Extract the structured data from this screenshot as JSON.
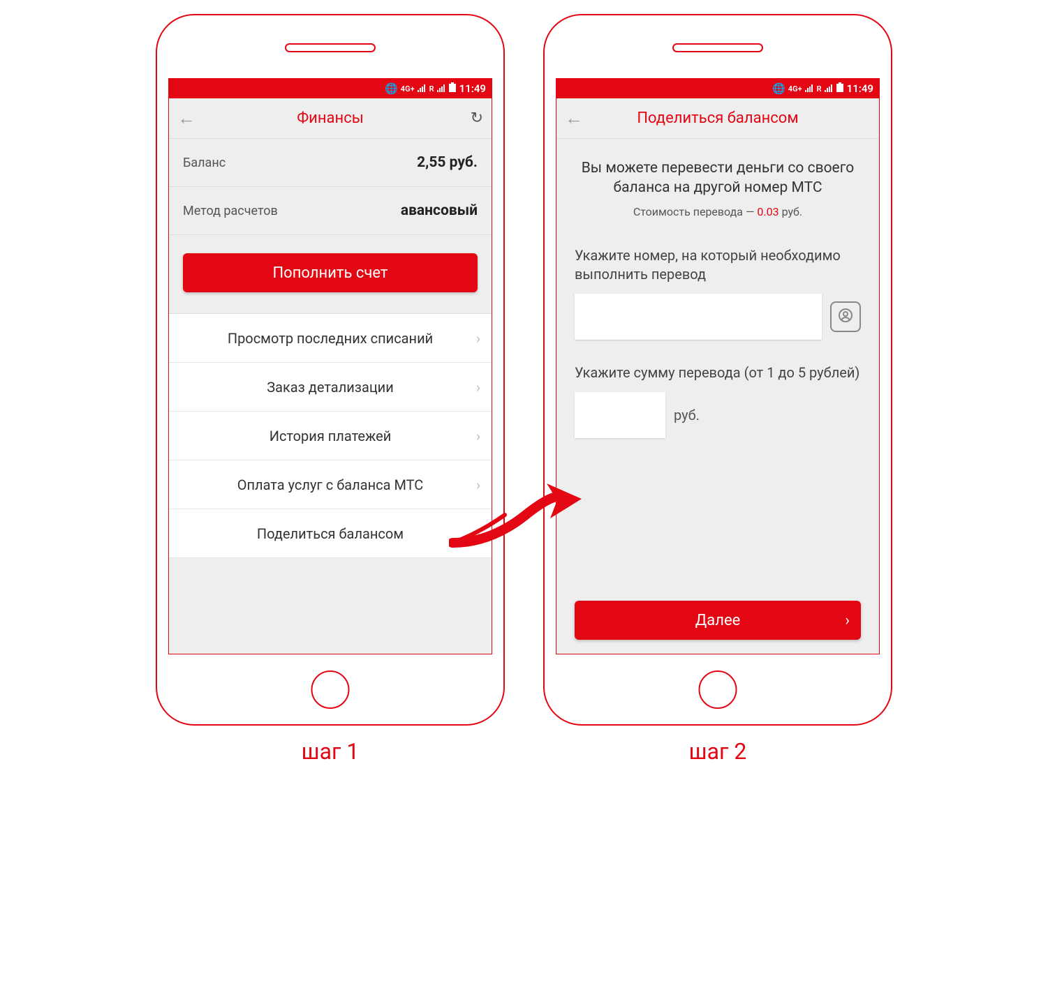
{
  "accent": "#e30613",
  "status": {
    "time": "11:49",
    "net_label": "4G+",
    "roam_label": "R",
    "icons": [
      "globe-icon",
      "4g-icon",
      "signal-icon",
      "signal-roaming-icon",
      "battery-icon"
    ]
  },
  "step_labels": {
    "s1": "шаг 1",
    "s2": "шаг 2"
  },
  "screen1": {
    "header_title": "Финансы",
    "balance_label": "Баланс",
    "balance_value": "2,55 руб.",
    "method_label": "Метод расчетов",
    "method_value": "авансовый",
    "topup_button": "Пополнить счет",
    "menu": [
      "Просмотр последних списаний",
      "Заказ детализации",
      "История платежей",
      "Оплата услуг с баланса МТС",
      "Поделиться балансом"
    ]
  },
  "screen2": {
    "header_title": "Поделиться балансом",
    "intro_line": "Вы можете перевести деньги со своего баланса на другой номер МТС",
    "fee_prefix": "Стоимость перевода — ",
    "fee_value": "0.03",
    "fee_suffix": " руб.",
    "phone_label": "Укажите номер, на который необходимо выполнить перевод",
    "amount_label": "Укажите сумму перевода (от 1 до 5 рублей)",
    "amount_unit": "руб.",
    "next_button": "Далее"
  }
}
